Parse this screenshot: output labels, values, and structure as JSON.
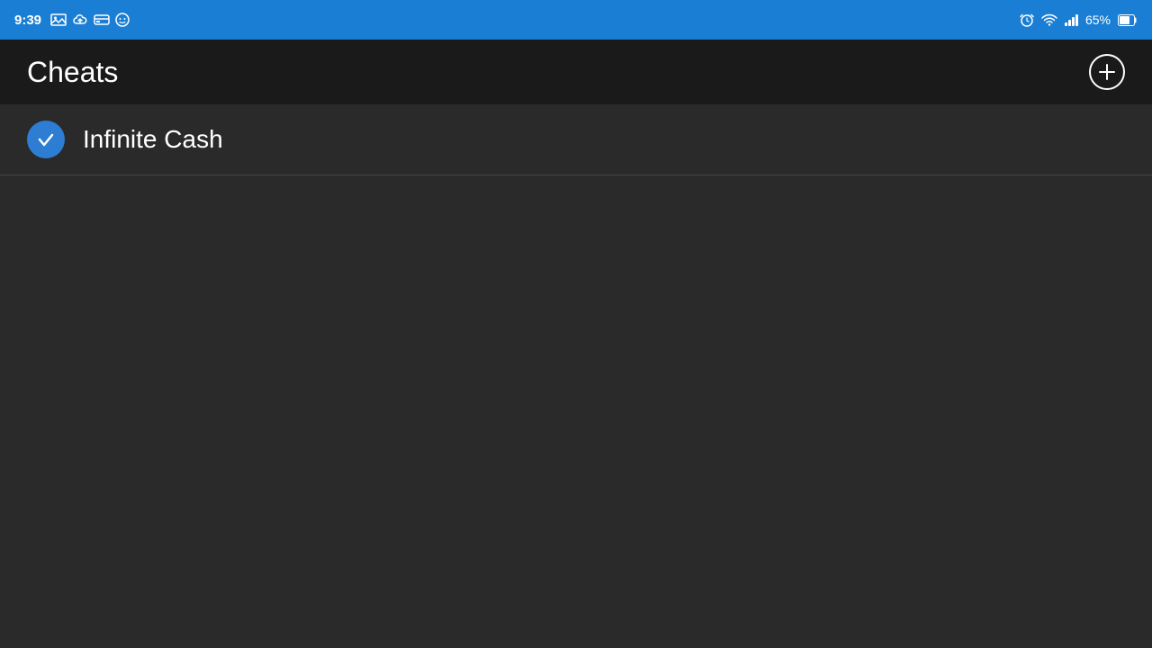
{
  "statusBar": {
    "time": "9:39",
    "batteryPercent": "65%",
    "icons": {
      "image": "image-icon",
      "cloud": "cloud-icon",
      "card": "card-icon",
      "face": "face-icon",
      "alarm": "alarm-icon",
      "wifi": "wifi-icon",
      "signal": "signal-icon",
      "battery": "battery-icon"
    }
  },
  "header": {
    "title": "Cheats",
    "addButton": "+"
  },
  "list": {
    "items": [
      {
        "id": 1,
        "label": "Infinite Cash",
        "checked": true
      }
    ]
  }
}
